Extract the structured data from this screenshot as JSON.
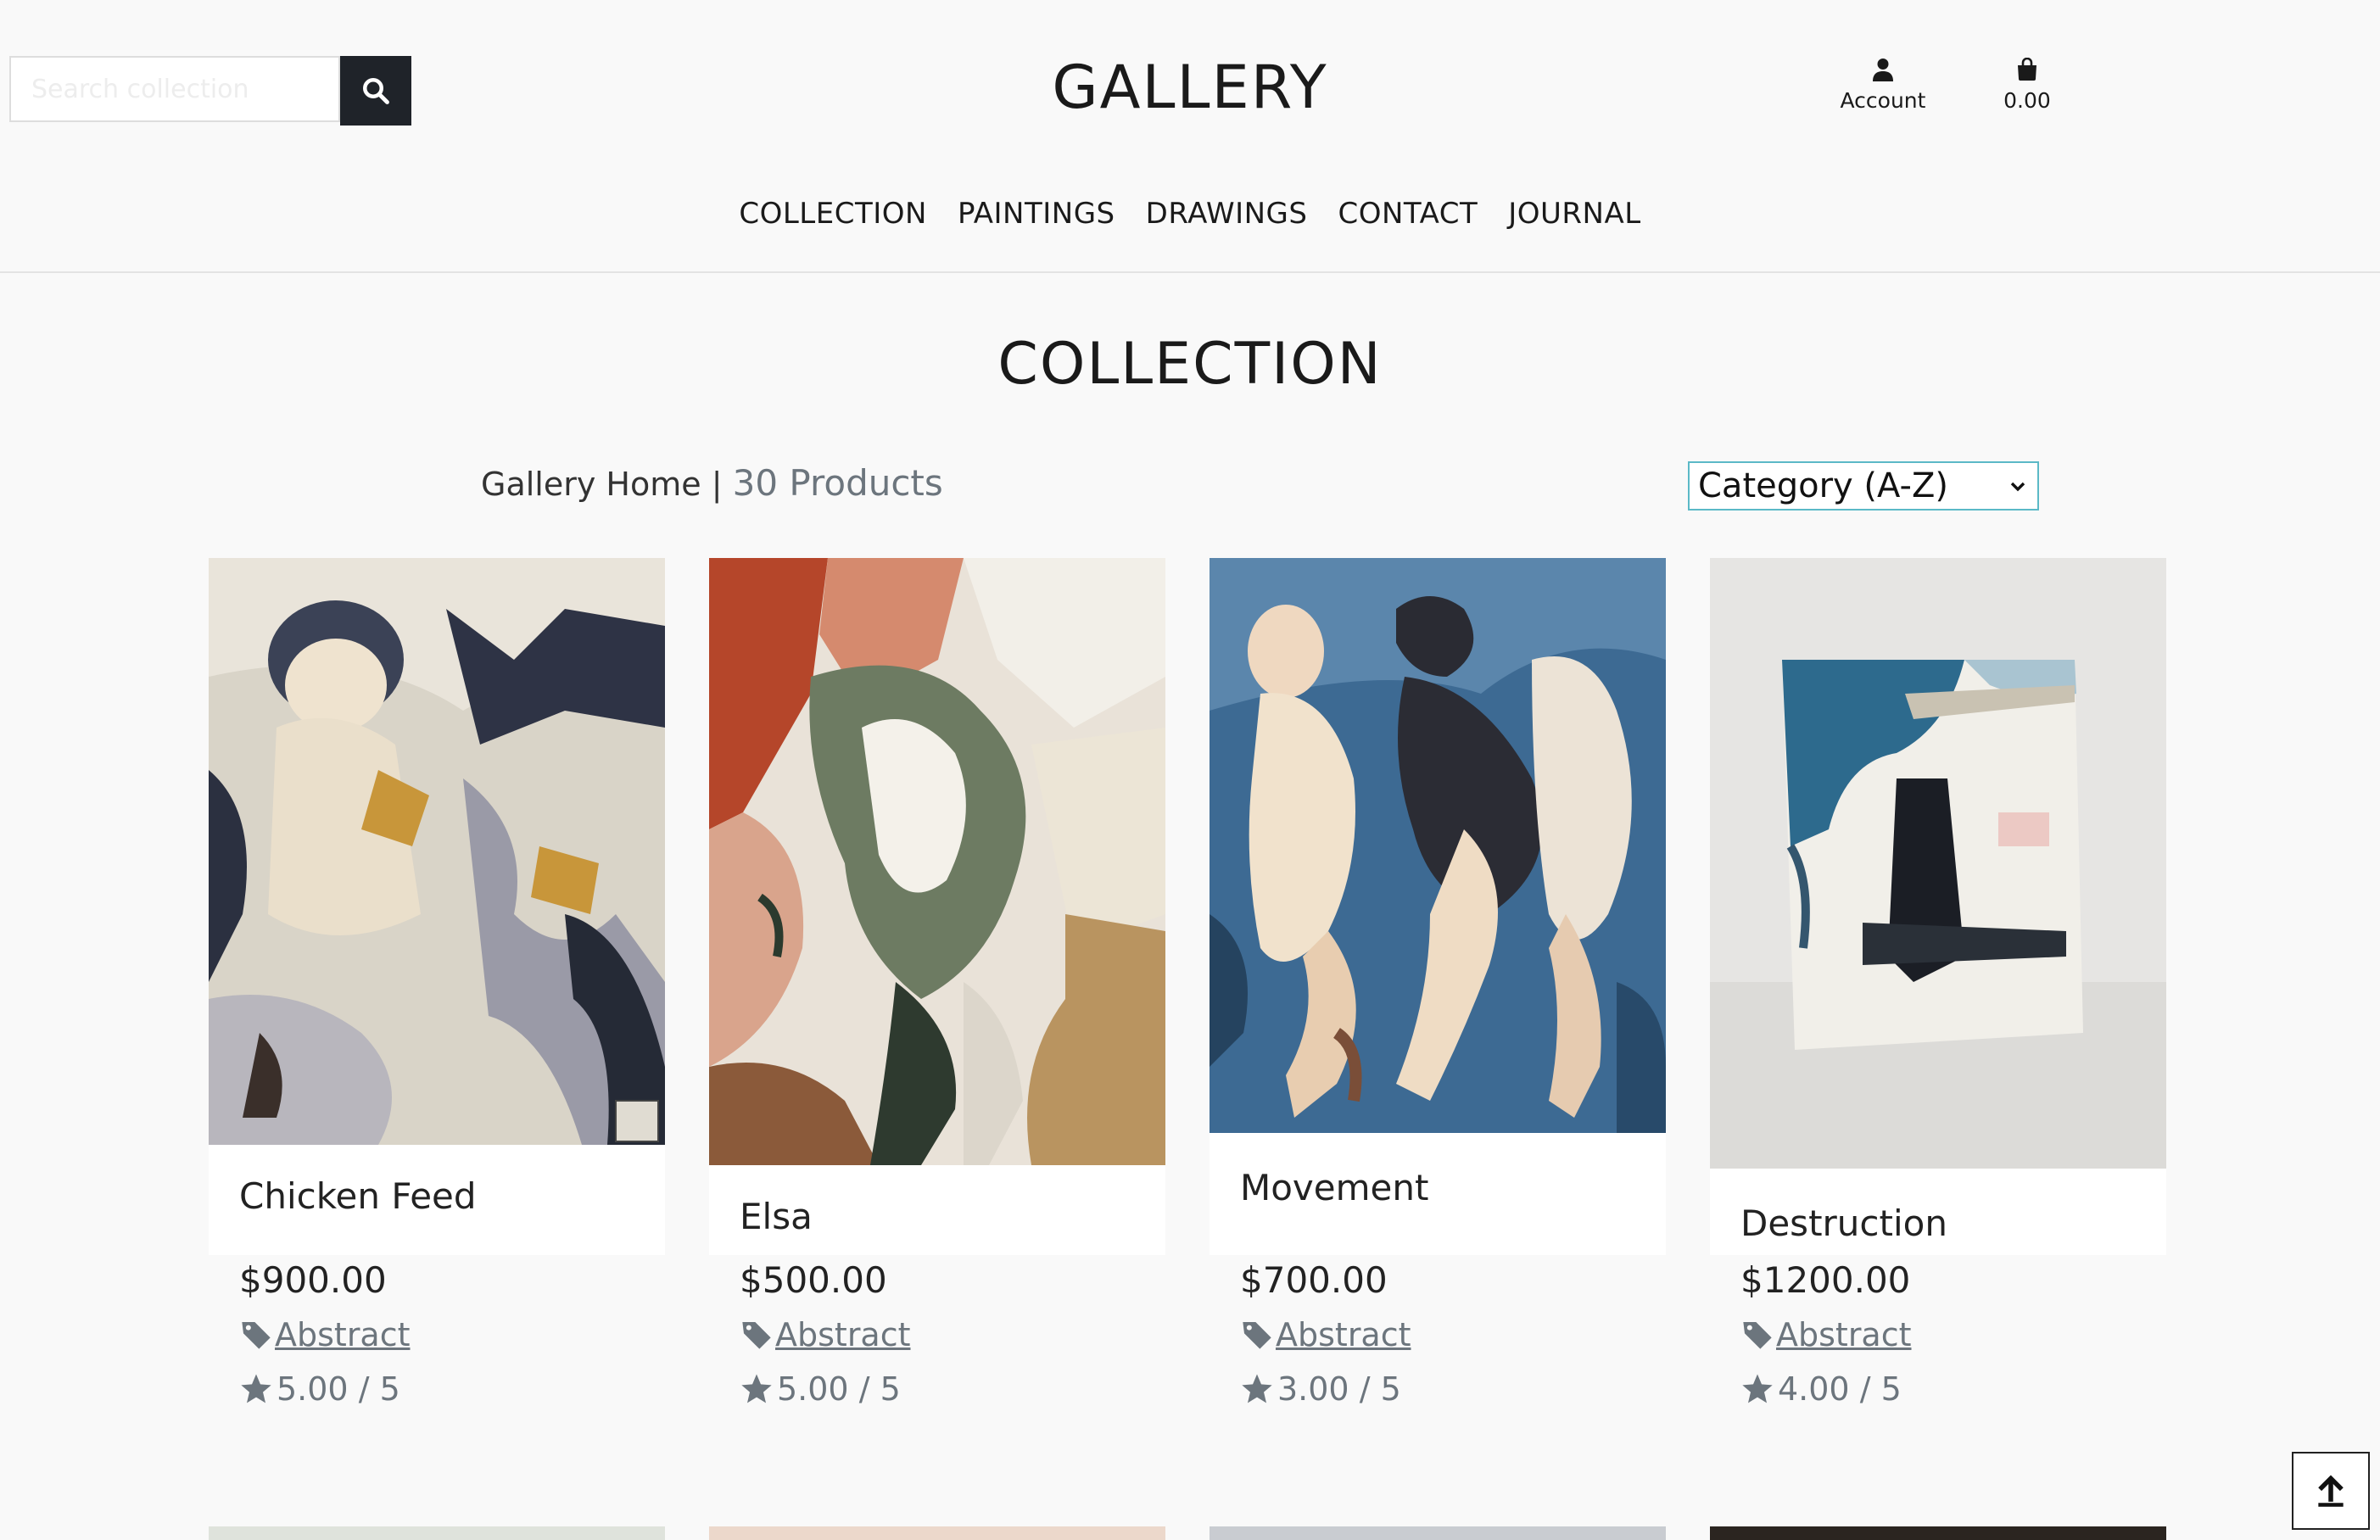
{
  "header": {
    "search_placeholder": "Search collection",
    "brand": "GALLERY",
    "account_label": "Account",
    "bag_total": "0.00"
  },
  "nav": [
    "COLLECTION",
    "PAINTINGS",
    "DRAWINGS",
    "CONTACT",
    "JOURNAL"
  ],
  "page": {
    "title": "COLLECTION",
    "breadcrumb": "Gallery Home",
    "separator": "|",
    "product_count": "30 Products",
    "sort_selected": "Category (A-Z)"
  },
  "products": [
    {
      "name": "Chicken Feed",
      "price": "$900.00",
      "category": "Abstract",
      "rating": "5.00 / 5"
    },
    {
      "name": "Elsa",
      "price": "$500.00",
      "category": "Abstract",
      "rating": "5.00 / 5"
    },
    {
      "name": "Movement",
      "price": "$700.00",
      "category": "Abstract",
      "rating": "3.00 / 5"
    },
    {
      "name": "Destruction",
      "price": "$1200.00",
      "category": "Abstract",
      "rating": "4.00 / 5"
    }
  ],
  "colors": {
    "accent_dark": "#1f2329",
    "muted_text": "#6c757d",
    "select_border": "#5bb9c7",
    "background": "#f9f9f9"
  },
  "icons": [
    "search-icon",
    "user-icon",
    "shopping-bag-icon",
    "tag-icon",
    "star-icon",
    "arrow-up-icon",
    "chevron-down-icon"
  ]
}
